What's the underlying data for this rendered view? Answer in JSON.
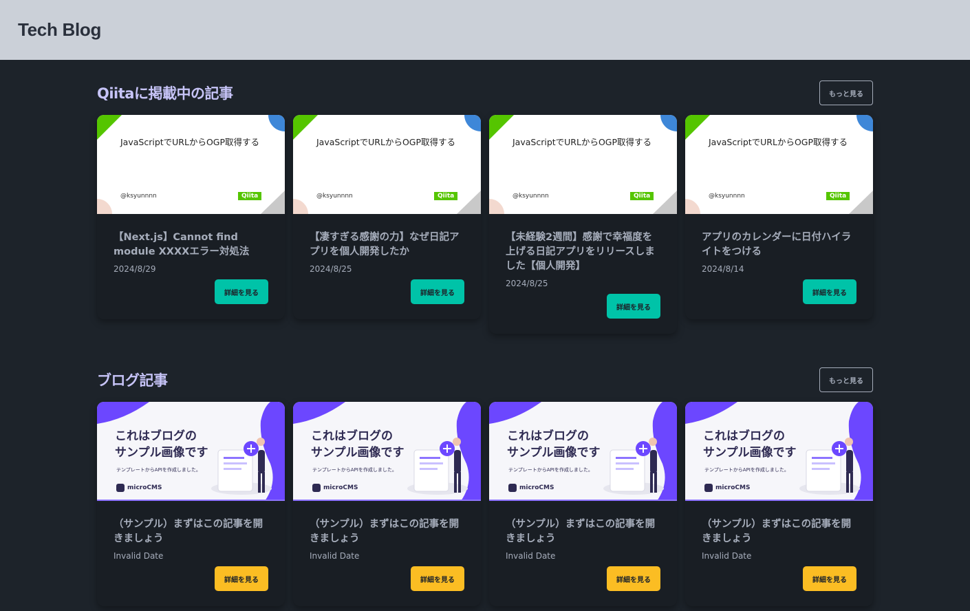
{
  "header": {
    "title": "Tech Blog"
  },
  "qiita_section": {
    "title": "Qiitaに掲載中の記事",
    "more_label": "もっと見る",
    "detail_label": "詳細を見る",
    "ogp": {
      "title": "JavaScriptでURLからOGP取得する",
      "user": "@ksyunnnn",
      "logo": "Qiita"
    },
    "cards": [
      {
        "title": "【Next.js】Cannot find module XXXXエラー対処法",
        "date": "2024/8/29"
      },
      {
        "title": "【凄すぎる感謝の力】なぜ日記アプリを個人開発したか",
        "date": "2024/8/25"
      },
      {
        "title": "【未経験2週間】感謝で幸福度を上げる日記アプリをリリースしました【個人開発】",
        "date": "2024/8/25"
      },
      {
        "title": "アプリのカレンダーに日付ハイライトをつける",
        "date": "2024/8/14"
      }
    ]
  },
  "blog_section": {
    "title": "ブログ記事",
    "more_label": "もっと見る",
    "detail_label": "詳細を見る",
    "sample_image": {
      "line1": "これはブログの",
      "line2": "サンプル画像です",
      "sub": "テンプレートからAPIを作成しました。",
      "logo": "microCMS"
    },
    "cards": [
      {
        "title": "（サンプル）まずはこの記事を開きましょう",
        "date": "Invalid Date"
      },
      {
        "title": "（サンプル）まずはこの記事を開きましょう",
        "date": "Invalid Date"
      },
      {
        "title": "（サンプル）まずはこの記事を開きましょう",
        "date": "Invalid Date"
      },
      {
        "title": "（サンプル）まずはこの記事を開きましょう",
        "date": "Invalid Date"
      }
    ]
  },
  "colors": {
    "background": "#1d232a",
    "header_bg": "#cbd0d8",
    "section_title": "#c7c4f8",
    "qiita_button": "#00c3a8",
    "blog_button": "#fbbd23",
    "qiita_green": "#55c500",
    "blog_purple": "#6c47ff"
  }
}
